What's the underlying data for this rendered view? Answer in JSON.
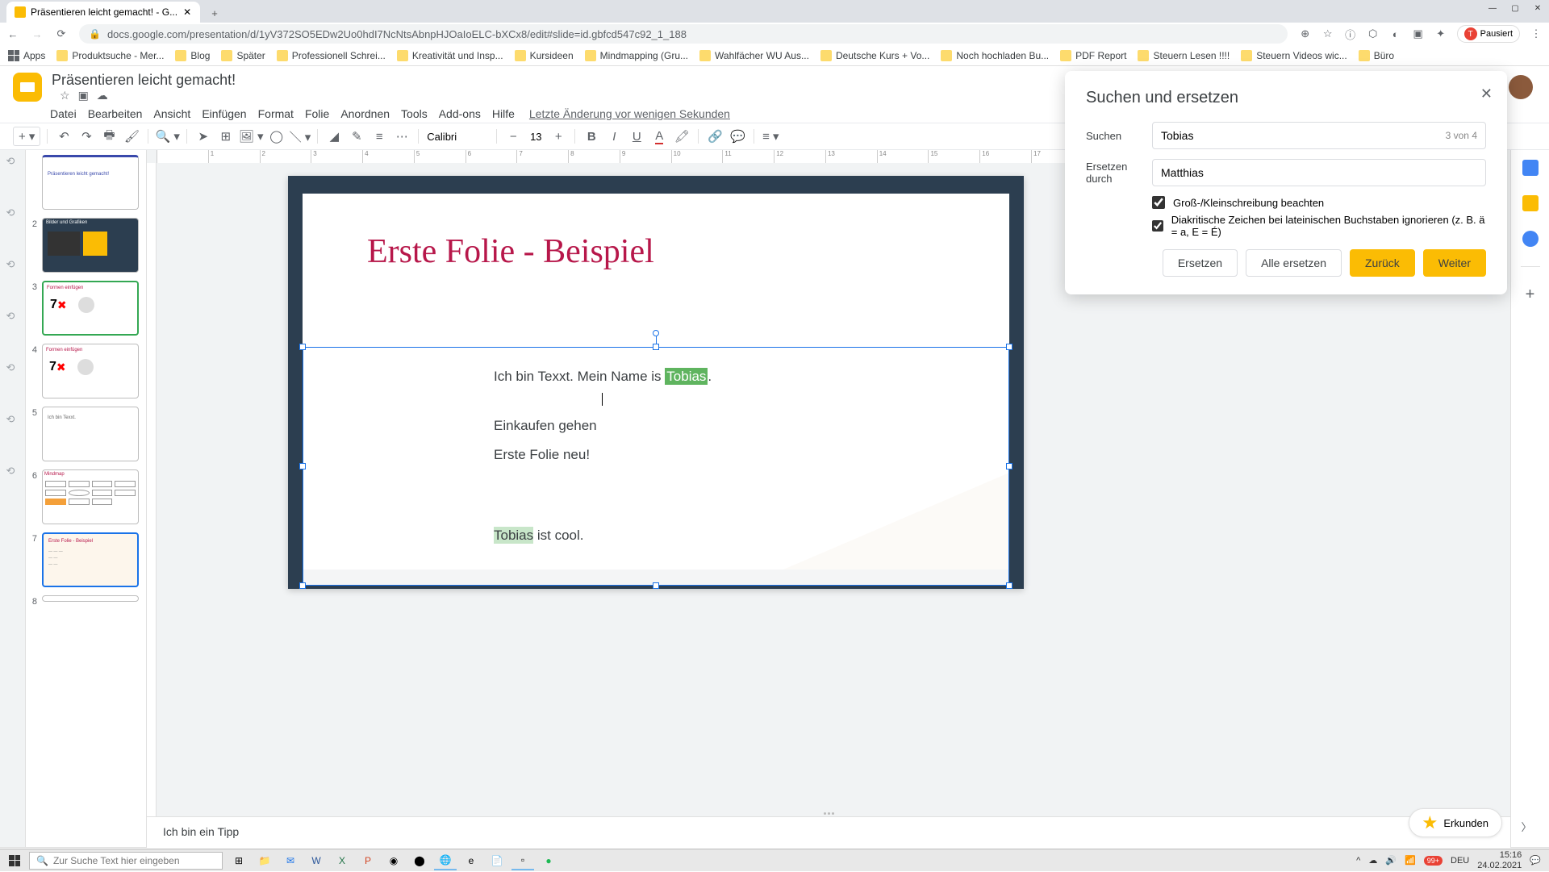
{
  "browser": {
    "tab_title": "Präsentieren leicht gemacht! - G...",
    "url": "docs.google.com/presentation/d/1yV372SO5EDw2Uo0hdI7NcNtsAbnpHJOaIoELC-bXCx8/edit#slide=id.gbfcd547c92_1_188",
    "paused_label": "Pausiert"
  },
  "bookmarks": {
    "apps": "Apps",
    "items": [
      "Produktsuche - Mer...",
      "Blog",
      "Später",
      "Professionell Schrei...",
      "Kreativität und Insp...",
      "Kursideen",
      "Mindmapping  (Gru...",
      "Wahlfächer WU Aus...",
      "Deutsche Kurs + Vo...",
      "Noch hochladen Bu...",
      "PDF Report",
      "Steuern Lesen !!!!",
      "Steuern Videos wic...",
      "Büro"
    ]
  },
  "app": {
    "doc_title": "Präsentieren leicht gemacht!",
    "menus": [
      "Datei",
      "Bearbeiten",
      "Ansicht",
      "Einfügen",
      "Format",
      "Folie",
      "Anordnen",
      "Tools",
      "Add-ons",
      "Hilfe"
    ],
    "last_edit": "Letzte Änderung vor wenigen Sekunden"
  },
  "toolbar": {
    "font": "Calibri",
    "size": "13"
  },
  "thumbs": {
    "n1": "Präsentieren leicht gemacht!",
    "n2": "Bilder und Grafiken",
    "n3": "Formen einfügen",
    "n3b": "7",
    "n4": "Formen einfügen",
    "n4b": "7",
    "n5": "Ich bin Texxt.",
    "n6": "Mindmap",
    "n7": "Erste Folie - Beispiel"
  },
  "slide": {
    "title": "Erste Folie - Beispiel",
    "text_before1": "Ich bin Texxt. Mein Name is ",
    "text_match1": "Tobias",
    "text_after1": ".",
    "line2": "Einkaufen gehen",
    "line3": "Erste Folie neu!",
    "text_match2": "Tobias",
    "text_after2": " ist cool."
  },
  "notes": "Ich bin ein Tipp",
  "dialog": {
    "title": "Suchen und ersetzen",
    "search_label": "Suchen",
    "search_value": "Tobias",
    "search_count": "3 von 4",
    "replace_label": "Ersetzen durch",
    "replace_value": "Matthias",
    "check1": "Groß-/Kleinschreibung beachten",
    "check2": "Diakritische Zeichen bei lateinischen Buchstaben ignorieren (z. B. ä = a, E = É)",
    "btn_replace": "Ersetzen",
    "btn_replace_all": "Alle ersetzen",
    "btn_back": "Zurück",
    "btn_next": "Weiter"
  },
  "explore": "Erkunden",
  "taskbar": {
    "search_placeholder": "Zur Suche Text hier eingeben",
    "notif_count": "99+",
    "lang": "DEU",
    "time": "15:16",
    "date": "24.02.2021"
  }
}
